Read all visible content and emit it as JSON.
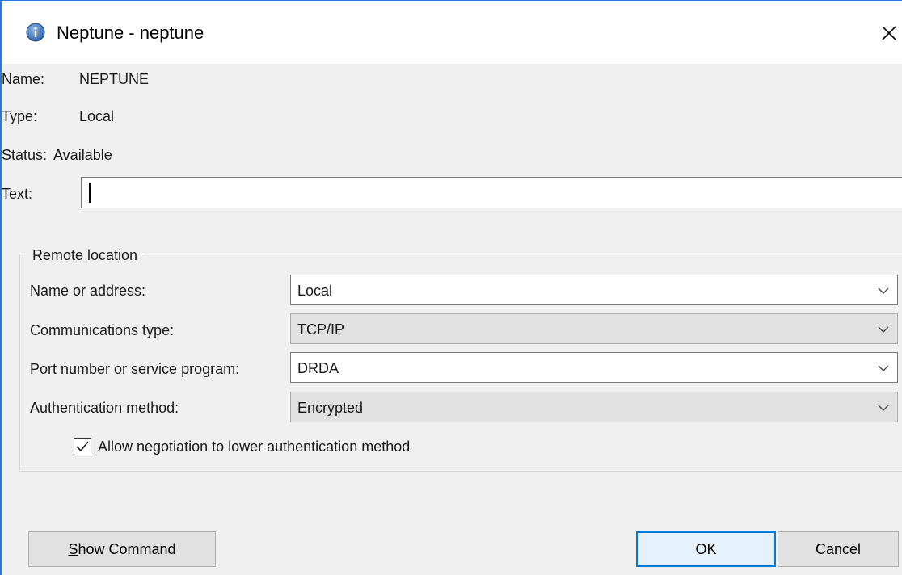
{
  "window": {
    "title": "Neptune - neptune"
  },
  "info": {
    "name_label": "Name:",
    "name_value": "NEPTUNE",
    "type_label": "Type:",
    "type_value": "Local",
    "status_label": "Status:",
    "status_value": "Available",
    "text_label": "Text:",
    "text_value": ""
  },
  "remote": {
    "group_title": "Remote location",
    "name_or_address_label": "Name or address:",
    "name_or_address_value": "Local",
    "comm_type_label": "Communications type:",
    "comm_type_value": "TCP/IP",
    "port_label": "Port number or service program:",
    "port_value": "DRDA",
    "auth_label": "Authentication method:",
    "auth_value": "Encrypted",
    "allow_negotiation_label": "Allow negotiation to lower authentication method",
    "allow_negotiation_checked": true
  },
  "buttons": {
    "show_command": "Show Command",
    "ok": "OK",
    "cancel": "Cancel"
  },
  "colors": {
    "accent": "#0078d7",
    "window_border": "#2b79d6",
    "dialog_bg": "#f0f0f0"
  },
  "icons": {
    "title": "info-icon",
    "close": "close-icon",
    "dropdown": "chevron-down-icon",
    "check": "checkmark-icon"
  }
}
